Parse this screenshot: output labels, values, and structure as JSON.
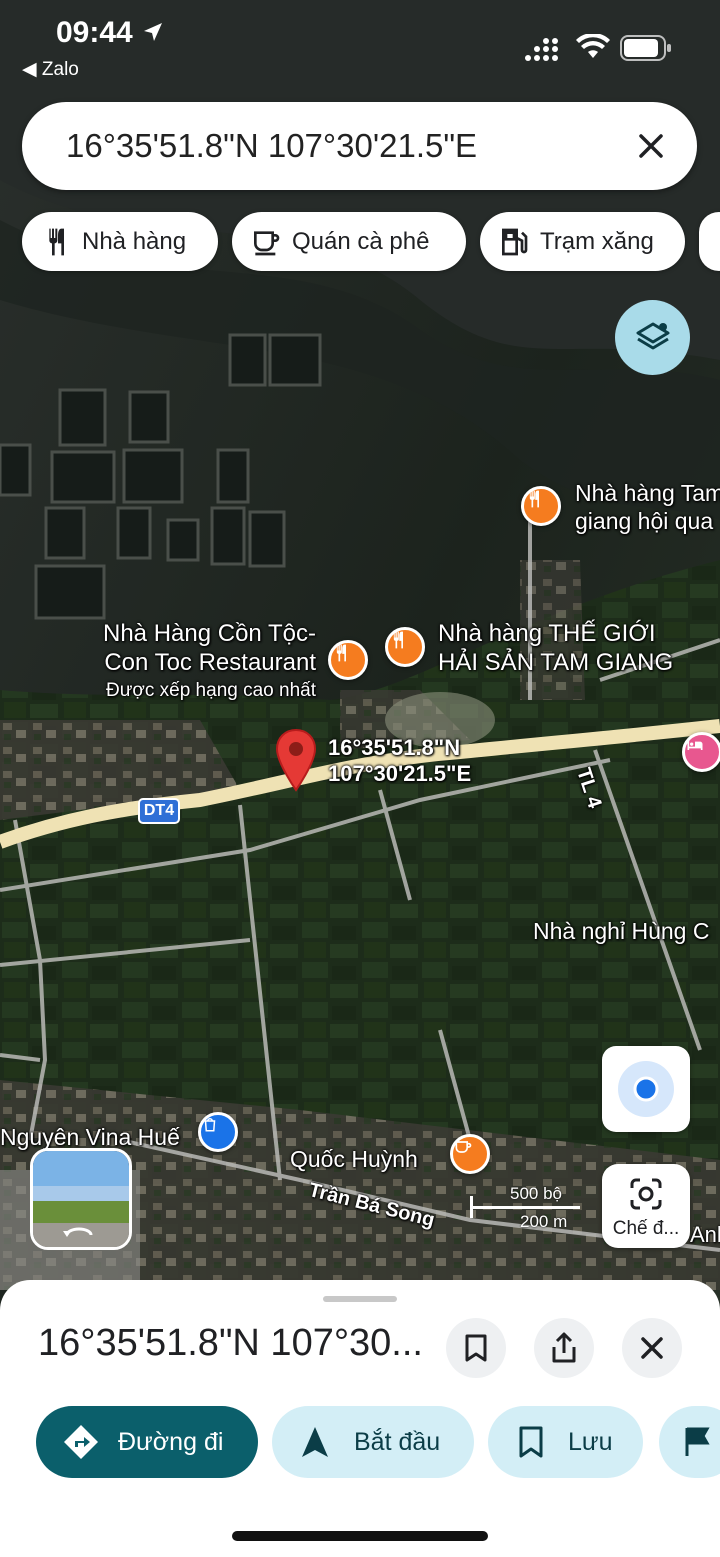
{
  "status_bar": {
    "time": "09:44",
    "back_app": "Zalo"
  },
  "search": {
    "value": "16°35'51.8\"N 107°30'21.5\"E"
  },
  "chips": [
    {
      "label": "Nhà hàng",
      "icon": "restaurant-icon"
    },
    {
      "label": "Quán cà phê",
      "icon": "coffee-icon"
    },
    {
      "label": "Trạm xăng",
      "icon": "gas-station-icon"
    }
  ],
  "map": {
    "places": [
      {
        "line1": "Nhà hàng Tam",
        "line2": "giang hội qua"
      },
      {
        "line1": "Nhà Hàng Cồn Tộc-",
        "line2": "Con Toc Restaurant",
        "note": "Được xếp hạng cao nhất"
      },
      {
        "line1": "Nhà hàng THẾ GIỚI",
        "line2": "HẢI SẢN TAM GIANG"
      },
      {
        "line1": "Nhà nghỉ Hùng C"
      },
      {
        "line1": "Nguyên Vina Huế"
      },
      {
        "line1": "Quốc Huỳnh"
      },
      {
        "line1": "Anh"
      }
    ],
    "pin_label": {
      "line1": "16°35'51.8\"N",
      "line2": "107°30'21.5\"E"
    },
    "roads": {
      "dt4": "DT4",
      "tl4": "TL 4",
      "street": "Trần Bá Song"
    },
    "scale": {
      "imperial": "500 bộ",
      "metric": "200 m"
    },
    "lens_label": "Chế đ..."
  },
  "sheet": {
    "title": "16°35'51.8\"N 107°30...",
    "actions": [
      {
        "label": "Đường đi",
        "icon": "directions-icon"
      },
      {
        "label": "Bắt đầu",
        "icon": "navigation-icon"
      },
      {
        "label": "Lưu",
        "icon": "bookmark-icon"
      }
    ]
  },
  "colors": {
    "accent_dark": "#0b5f6b",
    "accent_light": "#d3eef6",
    "poi_orange": "#f57c1f",
    "pin_red": "#e53935",
    "hotel_pink": "#e8578f",
    "shop_blue": "#1a73e8"
  }
}
